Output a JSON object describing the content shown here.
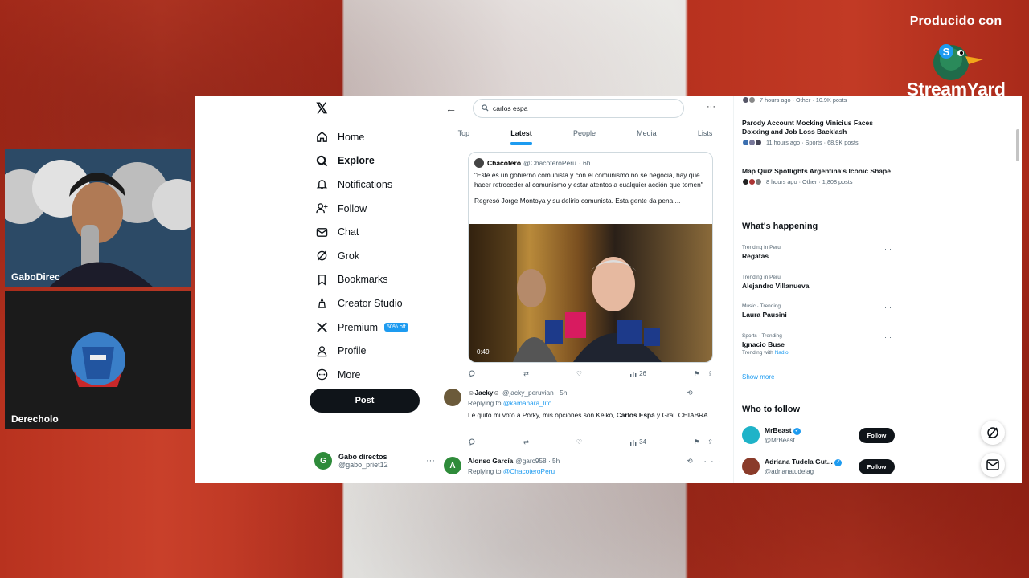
{
  "overlay": {
    "produced_with": "Producido con",
    "brand": "StreamYard",
    "cam1_name": "GaboDirec",
    "cam2_name": "Derecholo"
  },
  "nav": {
    "items": [
      {
        "label": "Home",
        "icon": "home-icon"
      },
      {
        "label": "Explore",
        "icon": "search-icon"
      },
      {
        "label": "Notifications",
        "icon": "bell-icon"
      },
      {
        "label": "Follow",
        "icon": "add-person-icon"
      },
      {
        "label": "Chat",
        "icon": "mail-icon"
      },
      {
        "label": "Grok",
        "icon": "grok-icon"
      },
      {
        "label": "Bookmarks",
        "icon": "bookmark-icon"
      },
      {
        "label": "Creator Studio",
        "icon": "creator-icon"
      },
      {
        "label": "Premium",
        "icon": "x-icon"
      },
      {
        "label": "Profile",
        "icon": "person-icon"
      },
      {
        "label": "More",
        "icon": "more-circle-icon"
      }
    ],
    "premium_badge": "50% off",
    "post_label": "Post",
    "account": {
      "name": "Gabo directos",
      "handle": "@gabo_priet12",
      "initial": "G"
    }
  },
  "search": {
    "value": "carlos espa"
  },
  "tabs": [
    "Top",
    "Latest",
    "People",
    "Media",
    "Lists"
  ],
  "quote": {
    "author": "Chacotero",
    "handle": "@ChacoteroPeru",
    "time": "· 6h",
    "text": "\"Este es un gobierno comunista y con el comunismo no se negocia, hay que hacer retroceder al comunismo y estar atentos a cualquier acción que tomen\"",
    "text2": "Regresó Jorge Montoya y su delirio comunista. Esta gente da pena ...",
    "video_time": "0:49",
    "views": "26"
  },
  "replies": [
    {
      "author": "☺Jacky☺",
      "handle": "@jacky_peruvian · 5h",
      "replying_label": "Replying to",
      "replying_to": "@kamahara_lito",
      "text_before": "Le quito mi voto a Porky, mis opciones son Keiko, ",
      "text_bold": "Carlos Espá",
      "text_after": " y Gral. CHIABRA",
      "views": "34",
      "avatar_color": "#6b5a3a"
    },
    {
      "author": "Alonso García",
      "handle": "@garc958 · 5h",
      "replying_label": "Replying to",
      "replying_to": "@ChacoteroPeru",
      "initial": "A",
      "avatar_color": "#2e8b3a"
    }
  ],
  "right": {
    "top_meta": "7 hours ago · Other · 10.9K posts",
    "stories": [
      {
        "title": "Parody Account Mocking Vinicius Faces Doxxing and Job Loss Backlash",
        "meta": "11 hours ago · Sports · 68.9K posts"
      },
      {
        "title": "Map Quiz Spotlights Argentina's Iconic Shape",
        "meta": "8 hours ago · Other · 1,808 posts"
      }
    ],
    "happening_title": "What's happening",
    "trends": [
      {
        "context": "Trending in Peru",
        "name": "Regatas"
      },
      {
        "context": "Trending in Peru",
        "name": "Alejandro Villanueva"
      },
      {
        "context": "Music · Trending",
        "name": "Laura Pausini"
      },
      {
        "context": "Sports · Trending",
        "name": "Ignacio Buse",
        "with_label": "Trending with",
        "with": "Nadio"
      }
    ],
    "show_more": "Show more",
    "who_title": "Who to follow",
    "follow": [
      {
        "name": "MrBeast",
        "handle": "@MrBeast",
        "button": "Follow"
      },
      {
        "name": "Adriana Tudela Gut...",
        "handle": "@adrianatudelag",
        "button": "Follow"
      }
    ]
  },
  "colors": {
    "accent": "#1d9bf0",
    "text": "#0f1419",
    "muted": "#536471"
  }
}
